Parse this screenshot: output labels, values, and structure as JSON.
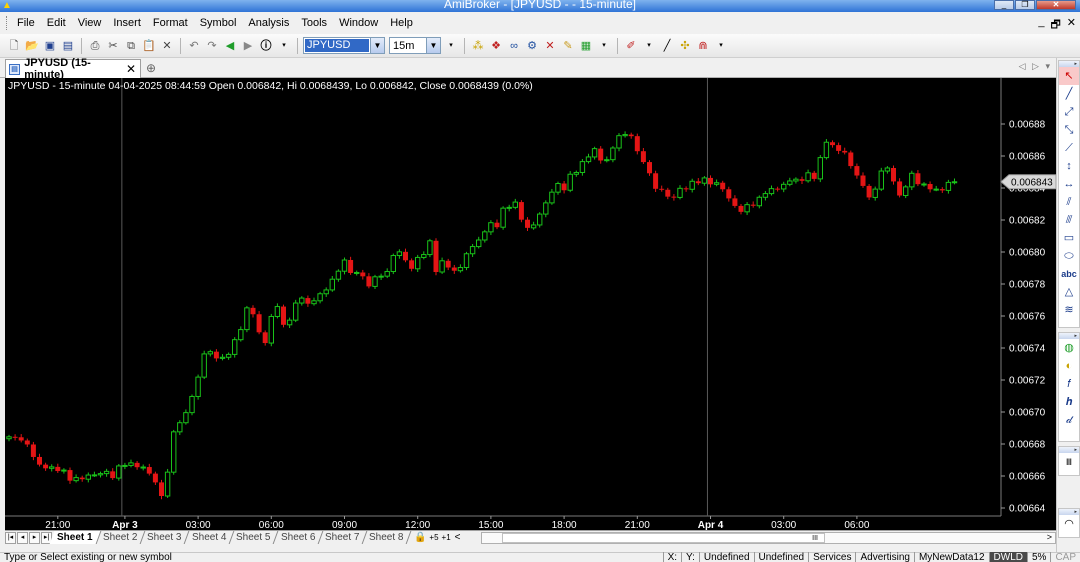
{
  "window": {
    "title": "AmiBroker - [JPYUSD -  - 15-minute]",
    "buttons": [
      "_",
      "❐",
      "✕"
    ]
  },
  "menu": {
    "items": [
      "File",
      "Edit",
      "View",
      "Insert",
      "Format",
      "Symbol",
      "Analysis",
      "Tools",
      "Window",
      "Help"
    ],
    "mdi": [
      "_",
      "🗗",
      "✕"
    ]
  },
  "toolbar": {
    "symbol": "JPYUSD",
    "interval": "15m"
  },
  "tab": {
    "label": "JPYUSD (15-minute)",
    "close": "✕",
    "new": "⊕",
    "nav": "◁ ▷ ▾"
  },
  "chart": {
    "info": "JPYUSD - 15-minute 04-04-2025 08:44:59 Open 0.006842, Hi 0.0068439, Lo 0.006842, Close 0.0068439 (0.0%)",
    "last_price_label": "0.006843"
  },
  "chart_data": {
    "type": "candlestick",
    "y_ticks": [
      "0.00688",
      "0.00686",
      "0.00684",
      "0.00682",
      "0.00680",
      "0.00678",
      "0.00676",
      "0.00674",
      "0.00672",
      "0.00670",
      "0.00668",
      "0.00666",
      "0.00664"
    ],
    "y_tick_values": [
      0.00688,
      0.00686,
      0.00684,
      0.00682,
      0.0068,
      0.00678,
      0.00676,
      0.00674,
      0.00672,
      0.0067,
      0.00668,
      0.00666,
      0.00664
    ],
    "ylim": [
      0.006635,
      0.006895
    ],
    "x_ticks": [
      "21:00",
      "Apr 3",
      "03:00",
      "06:00",
      "09:00",
      "12:00",
      "15:00",
      "18:00",
      "21:00",
      "Apr 4",
      "03:00",
      "06:00"
    ],
    "x_tick_bar_index": [
      8,
      19,
      31,
      43,
      55,
      67,
      79,
      91,
      103,
      115,
      127,
      139
    ],
    "bold_ticks": [
      "Apr 3",
      "Apr 4"
    ],
    "day_separator_bar_index": [
      18.5,
      114.5
    ],
    "last_price": 0.0068439,
    "close": [
      0.0066845,
      0.0066842,
      0.0066822,
      0.0066797,
      0.0066719,
      0.0066671,
      0.0066648,
      0.0066657,
      0.0066631,
      0.0066637,
      0.0066571,
      0.006659,
      0.006658,
      0.0066606,
      0.0066607,
      0.0066615,
      0.0066629,
      0.0066587,
      0.0066663,
      0.0066666,
      0.0066682,
      0.0066655,
      0.0066656,
      0.0066615,
      0.006656,
      0.0066475,
      0.0066624,
      0.0066876,
      0.0066933,
      0.0066996,
      0.0067097,
      0.0067218,
      0.0067363,
      0.0067377,
      0.0067335,
      0.0067342,
      0.006736,
      0.0067452,
      0.0067515,
      0.0067651,
      0.0067611,
      0.0067498,
      0.0067431,
      0.0067597,
      0.0067659,
      0.0067545,
      0.0067574,
      0.0067681,
      0.0067712,
      0.0067677,
      0.0067695,
      0.0067739,
      0.0067763,
      0.006783,
      0.006788,
      0.006795,
      0.0067869,
      0.0067872,
      0.0067848,
      0.0067785,
      0.0067845,
      0.0067849,
      0.0067878,
      0.0067978,
      0.0068001,
      0.0067948,
      0.0067895,
      0.0067966,
      0.0067984,
      0.006807,
      0.0067875,
      0.0067945,
      0.0067903,
      0.0067883,
      0.0067903,
      0.0067989,
      0.0068034,
      0.0068075,
      0.0068126,
      0.0068183,
      0.0068155,
      0.0068274,
      0.0068279,
      0.0068312,
      0.0068202,
      0.0068151,
      0.0068169,
      0.0068237,
      0.0068307,
      0.0068374,
      0.0068428,
      0.0068386,
      0.0068486,
      0.0068497,
      0.0068565,
      0.0068594,
      0.0068646,
      0.0068572,
      0.0068577,
      0.006865,
      0.0068727,
      0.0068734,
      0.0068724,
      0.006863,
      0.0068562,
      0.0068492,
      0.0068395,
      0.0068389,
      0.0068346,
      0.0068341,
      0.0068398,
      0.0068392,
      0.0068442,
      0.006843,
      0.0068463,
      0.0068423,
      0.0068433,
      0.0068392,
      0.0068335,
      0.0068288,
      0.0068251,
      0.0068296,
      0.0068289,
      0.0068342,
      0.0068365,
      0.0068396,
      0.0068394,
      0.0068423,
      0.0068444,
      0.0068455,
      0.0068445,
      0.0068495,
      0.0068457,
      0.006859,
      0.0068686,
      0.0068668,
      0.0068632,
      0.0068622,
      0.0068537,
      0.0068478,
      0.0068413,
      0.0068341,
      0.0068393,
      0.0068506,
      0.0068525,
      0.0068441,
      0.0068353,
      0.0068407,
      0.0068492,
      0.0068424,
      0.0068425,
      0.0068392,
      0.0068393,
      0.0068385,
      0.0068435,
      0.0068439
    ]
  },
  "tools": [
    "↖",
    "╱",
    "⤢",
    "⤡",
    "⟋",
    "↕",
    "↔",
    "⫽",
    "⫻",
    "▭",
    "⬭",
    "abc",
    "△",
    "≋",
    "◍",
    "◐",
    "𝑓",
    "𝒉",
    "𝒹",
    "Ⅲ",
    "◠"
  ],
  "sheets": {
    "nav": [
      "|◂",
      "◂",
      "▸",
      "▸|"
    ],
    "tabs": [
      "Sheet 1",
      "Sheet 2",
      "Sheet 3",
      "Sheet 4",
      "Sheet 5",
      "Sheet 6",
      "Sheet 7",
      "Sheet 8"
    ],
    "extras": [
      "🔒",
      "+5",
      "+1",
      "<"
    ],
    "scroll_mark": "III",
    "scroll_right": ">"
  },
  "status": {
    "message": "Type or Select existing or new symbol",
    "cells": [
      "X:",
      "Y:",
      "Undefined",
      "Undefined",
      "Services",
      "Advertising",
      "MyNewData12",
      "DWLD",
      "5%",
      "CAP"
    ]
  }
}
